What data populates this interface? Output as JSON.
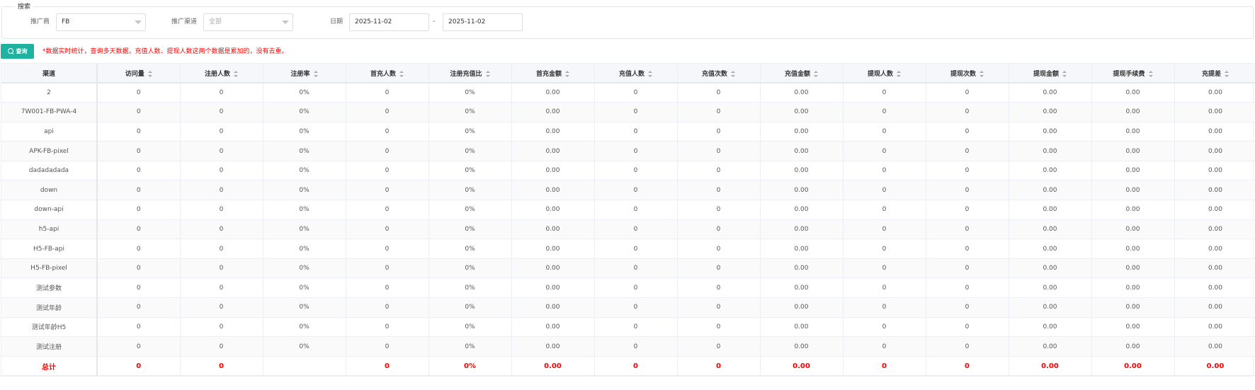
{
  "search": {
    "legend": "搜索",
    "promoter_label": "推广商",
    "promoter_value": "FB",
    "channel_label": "推广渠道",
    "channel_placeholder": "全部",
    "date_label": "日期",
    "date_start": "2025-11-02",
    "date_separator": "-",
    "date_end": "2025-11-02"
  },
  "query_button": {
    "label": "查询",
    "icon": "search-icon"
  },
  "notice": "*数据实时统计，查询多天数据，充值人数、提现人数这两个数据是累加的，没有去重。",
  "colors": {
    "accent": "#20b2a0",
    "notice": "#ff0000",
    "total": "#ff0000"
  },
  "table": {
    "headers": [
      "渠道",
      "访问量",
      "注册人数",
      "注册率",
      "首充人数",
      "注册充值比",
      "首充金额",
      "充值人数",
      "充值次数",
      "充值金额",
      "提现人数",
      "提现次数",
      "提现金额",
      "提现手续费",
      "充提差"
    ],
    "rows": [
      [
        "2",
        "0",
        "0",
        "0%",
        "0",
        "0%",
        "0.00",
        "0",
        "0",
        "0.00",
        "0",
        "0",
        "0.00",
        "0.00",
        "0.00"
      ],
      [
        "7W001-FB-PWA-4",
        "0",
        "0",
        "0%",
        "0",
        "0%",
        "0.00",
        "0",
        "0",
        "0.00",
        "0",
        "0",
        "0.00",
        "0.00",
        "0.00"
      ],
      [
        "api",
        "0",
        "0",
        "0%",
        "0",
        "0%",
        "0.00",
        "0",
        "0",
        "0.00",
        "0",
        "0",
        "0.00",
        "0.00",
        "0.00"
      ],
      [
        "APK-FB-pixel",
        "0",
        "0",
        "0%",
        "0",
        "0%",
        "0.00",
        "0",
        "0",
        "0.00",
        "0",
        "0",
        "0.00",
        "0.00",
        "0.00"
      ],
      [
        "dadadadada",
        "0",
        "0",
        "0%",
        "0",
        "0%",
        "0.00",
        "0",
        "0",
        "0.00",
        "0",
        "0",
        "0.00",
        "0.00",
        "0.00"
      ],
      [
        "down",
        "0",
        "0",
        "0%",
        "0",
        "0%",
        "0.00",
        "0",
        "0",
        "0.00",
        "0",
        "0",
        "0.00",
        "0.00",
        "0.00"
      ],
      [
        "down-api",
        "0",
        "0",
        "0%",
        "0",
        "0%",
        "0.00",
        "0",
        "0",
        "0.00",
        "0",
        "0",
        "0.00",
        "0.00",
        "0.00"
      ],
      [
        "h5-api",
        "0",
        "0",
        "0%",
        "0",
        "0%",
        "0.00",
        "0",
        "0",
        "0.00",
        "0",
        "0",
        "0.00",
        "0.00",
        "0.00"
      ],
      [
        "H5-FB-api",
        "0",
        "0",
        "0%",
        "0",
        "0%",
        "0.00",
        "0",
        "0",
        "0.00",
        "0",
        "0",
        "0.00",
        "0.00",
        "0.00"
      ],
      [
        "H5-FB-pixel",
        "0",
        "0",
        "0%",
        "0",
        "0%",
        "0.00",
        "0",
        "0",
        "0.00",
        "0",
        "0",
        "0.00",
        "0.00",
        "0.00"
      ],
      [
        "测试参数",
        "0",
        "0",
        "0%",
        "0",
        "0%",
        "0.00",
        "0",
        "0",
        "0.00",
        "0",
        "0",
        "0.00",
        "0.00",
        "0.00"
      ],
      [
        "测试年龄",
        "0",
        "0",
        "0%",
        "0",
        "0%",
        "0.00",
        "0",
        "0",
        "0.00",
        "0",
        "0",
        "0.00",
        "0.00",
        "0.00"
      ],
      [
        "测试年龄H5",
        "0",
        "0",
        "0%",
        "0",
        "0%",
        "0.00",
        "0",
        "0",
        "0.00",
        "0",
        "0",
        "0.00",
        "0.00",
        "0.00"
      ],
      [
        "测试注册",
        "0",
        "0",
        "0%",
        "0",
        "0%",
        "0.00",
        "0",
        "0",
        "0.00",
        "0",
        "0",
        "0.00",
        "0.00",
        "0.00"
      ]
    ],
    "total": [
      "总计",
      "0",
      "0",
      "",
      "0",
      "0%",
      "0.00",
      "0",
      "0",
      "0.00",
      "0",
      "0",
      "0.00",
      "0.00",
      "0.00"
    ]
  }
}
